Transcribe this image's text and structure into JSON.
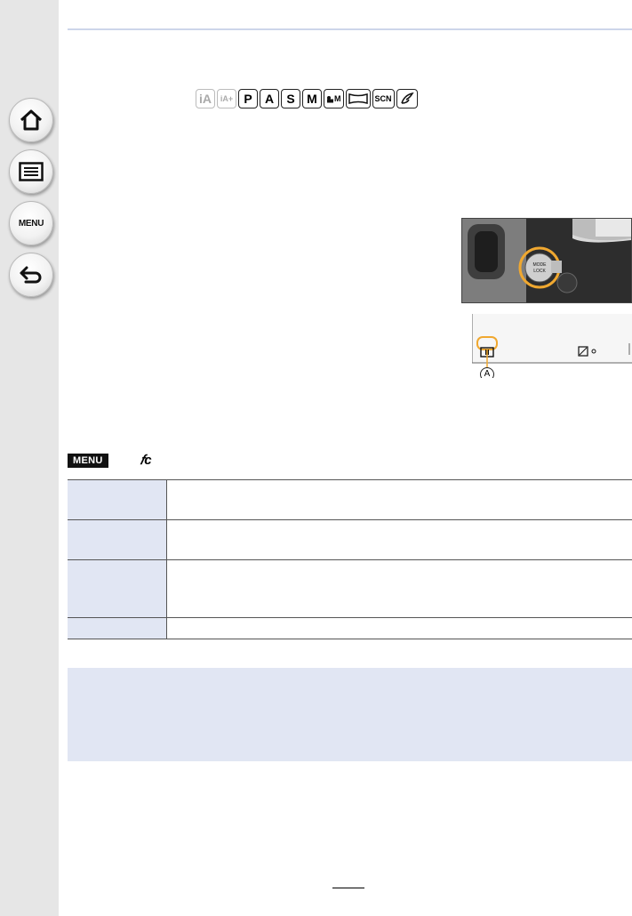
{
  "nav": {
    "items": [
      {
        "icon": "home-icon"
      },
      {
        "icon": "list-icon"
      },
      {
        "icon": "menu-icon",
        "label": "MENU"
      },
      {
        "icon": "back-icon"
      }
    ]
  },
  "modes": {
    "items": [
      "iA",
      "iA+",
      "P",
      "A",
      "S",
      "M",
      "M",
      "",
      "SCN",
      ""
    ]
  },
  "illustration": {
    "button_label_1": "MODE",
    "button_label_2": "LOCK",
    "callout": "A"
  },
  "menu_path": {
    "menu_label": "MENU",
    "setup_icon": "custom-setup-icon"
  },
  "table": {
    "rows": [
      {
        "key": "",
        "value": ""
      },
      {
        "key": "",
        "value": ""
      },
      {
        "key": "",
        "value": ""
      },
      {
        "key": "",
        "value": ""
      }
    ]
  },
  "colors": {
    "sidebar": "#e6e6e6",
    "accent_line": "#cdd6ea",
    "table_key_bg": "#e1e6f3",
    "highlight": "#f0a830"
  }
}
